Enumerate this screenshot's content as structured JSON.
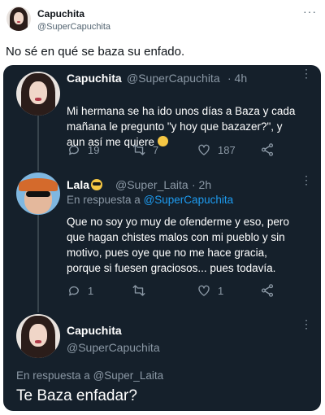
{
  "outer_tweet": {
    "display_name": "Capuchita",
    "handle": "@SuperCapuchita",
    "text": "No sé en qué se baza su enfado."
  },
  "thread": [
    {
      "display_name": "Capuchita",
      "handle": "@SuperCapuchita",
      "time": "· 4h",
      "text": "Mi hermana se ha ido unos días a Baza y cada\nmañana le pregunto \"y hoy que bazazer?\", y\naun así me quiere",
      "emoji": "relieved-face-emoji",
      "replies": "19",
      "retweets": "7",
      "likes": "187"
    },
    {
      "display_name": "Lala",
      "emoji": "sunglasses-face-emoji",
      "handle": "@Super_Laita",
      "time": "· 2h",
      "reply_prefix": "En respuesta a",
      "reply_to": "@SuperCapuchita",
      "text": "Que no soy yo muy de ofenderme y eso, pero\nque hagan chistes malos con mi pueblo y sin\nmotivo, pues oye  que no me hace gracia,\nporque si fuesen graciosos... pues todavía.",
      "replies": "1",
      "retweets": "",
      "likes": "1"
    },
    {
      "display_name": "Capuchita",
      "handle": "@SuperCapuchita",
      "reply_prefix": "En respuesta a",
      "reply_to": "@Super_Laita",
      "text": "Te Baza enfadar?"
    }
  ],
  "colors": {
    "card_bg": "#15202b",
    "muted": "#8b98a5",
    "accent": "#1d9bf0"
  }
}
